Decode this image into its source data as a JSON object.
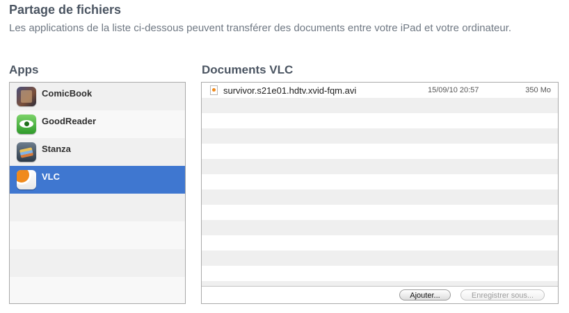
{
  "header": {
    "title": "Partage de fichiers",
    "subtitle": "Les applications de la liste ci-dessous peuvent transférer des documents entre votre iPad et votre ordinateur."
  },
  "apps_section": {
    "heading": "Apps",
    "items": [
      {
        "label": "ComicBook",
        "icon": "comicbook-app-icon",
        "selected": false
      },
      {
        "label": "GoodReader",
        "icon": "goodreader-app-icon",
        "selected": false
      },
      {
        "label": "Stanza",
        "icon": "stanza-app-icon",
        "selected": false
      },
      {
        "label": "VLC",
        "icon": "vlc-app-icon",
        "selected": true
      }
    ]
  },
  "documents_section": {
    "heading": "Documents VLC",
    "files": [
      {
        "name": "survivor.s21e01.hdtv.xvid-fqm.avi",
        "date": "15/09/10 20:57",
        "size": "350 Mo",
        "icon": "video-file-icon"
      }
    ],
    "buttons": {
      "add": "Ajouter...",
      "save_as": "Enregistrer sous..."
    }
  },
  "colors": {
    "selection": "#3f77d0",
    "heading": "#4b5562"
  }
}
